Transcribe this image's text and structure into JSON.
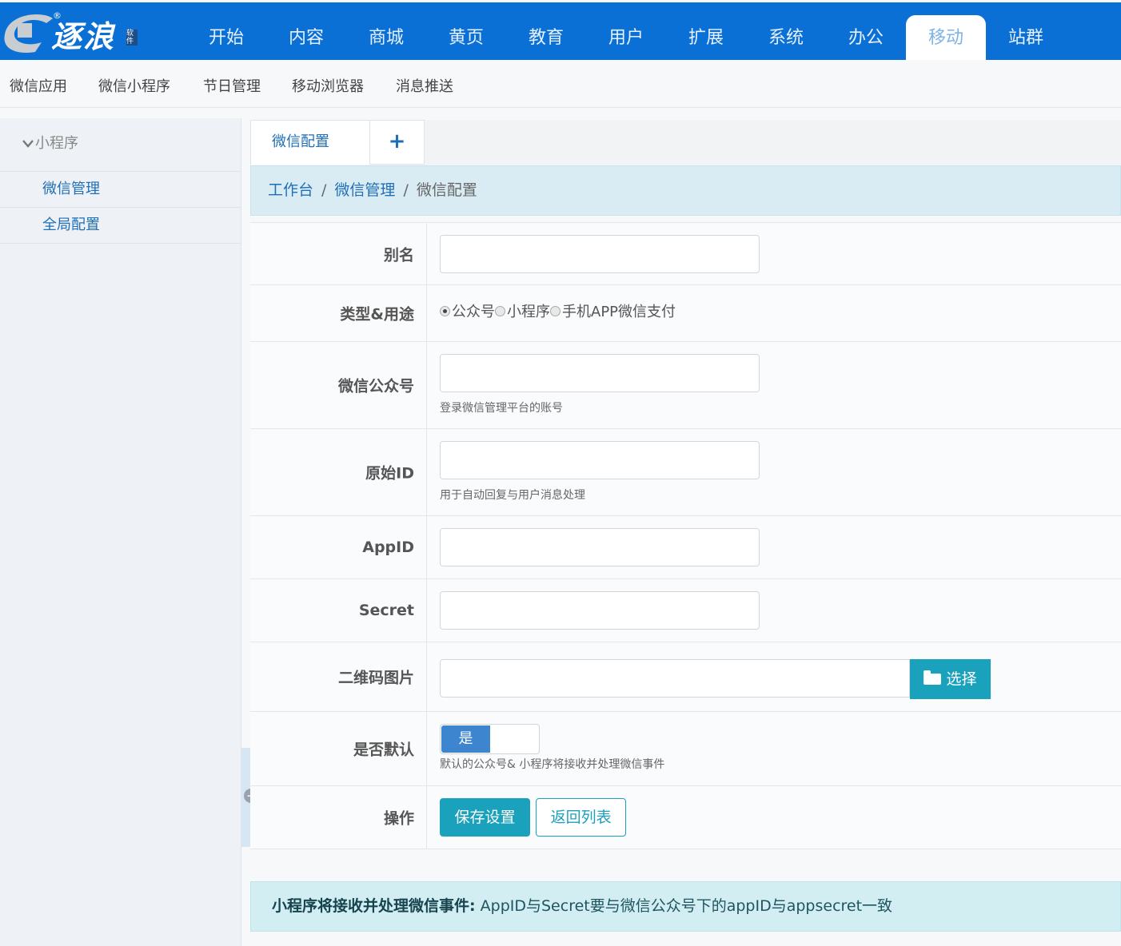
{
  "logo": {
    "text": "逐浪",
    "reg": "®",
    "side": "软件"
  },
  "topnav": {
    "items": [
      "开始",
      "内容",
      "商城",
      "黄页",
      "教育",
      "用户",
      "扩展",
      "系统",
      "办公",
      "移动",
      "站群"
    ],
    "active_index": 9
  },
  "subnav": {
    "items": [
      "微信应用",
      "微信小程序",
      "节日管理",
      "移动浏览器",
      "消息推送"
    ]
  },
  "sidebar": {
    "group": "小程序",
    "links": [
      "微信管理",
      "全局配置"
    ]
  },
  "tabs": {
    "active": "微信配置",
    "add": "+"
  },
  "breadcrumb": {
    "home": "工作台",
    "parent": "微信管理",
    "current": "微信配置",
    "sep": "/"
  },
  "form": {
    "alias": {
      "label": "别名",
      "value": ""
    },
    "type": {
      "label": "类型&用途",
      "options": [
        "公众号",
        "小程序",
        "手机APP微信支付"
      ],
      "selected_index": 0
    },
    "account": {
      "label": "微信公众号",
      "value": "",
      "help": "登录微信管理平台的账号"
    },
    "original_id": {
      "label": "原始ID",
      "value": "",
      "help": "用于自动回复与用户消息处理"
    },
    "appid": {
      "label": "AppID",
      "value": ""
    },
    "secret": {
      "label": "Secret",
      "value": ""
    },
    "qrcode": {
      "label": "二维码图片",
      "value": "",
      "button": "选择"
    },
    "is_default": {
      "label": "是否默认",
      "toggle": "是",
      "help": "默认的公众号& 小程序将接收并处理微信事件"
    },
    "actions": {
      "label": "操作",
      "save": "保存设置",
      "back": "返回列表"
    }
  },
  "alert": {
    "strong": "小程序将接收并处理微信事件:",
    "text": " AppID与Secret要与微信公众号下的appID与appsecret一致"
  },
  "colors": {
    "primary": "#0b70d6",
    "accent": "#1aa1bc",
    "link": "#1f6fb8"
  }
}
